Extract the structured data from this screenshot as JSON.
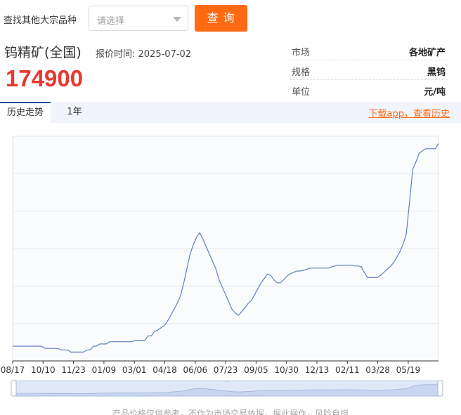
{
  "search": {
    "label": "查找其他大宗品种",
    "placeholder": "请选择",
    "button": "查 询"
  },
  "product": {
    "name": "钨精矿(全国)",
    "quote_time": "报价时间: 2025-07-02",
    "price": "174900"
  },
  "info": [
    {
      "key": "市场",
      "value": "各地矿产"
    },
    {
      "key": "规格",
      "value": "黑钨"
    },
    {
      "key": "单位",
      "value": "元/吨"
    }
  ],
  "tabs": {
    "history": "历史走势",
    "year": "1年",
    "download": "下载app，查看历史"
  },
  "disclaimer": "产品价格仅供参考，不作为市场交易依据，据此操作，风险自担",
  "colors": {
    "accent": "#ff6a13",
    "price": "#e8382f",
    "line": "#5b7fc0"
  },
  "chart_data": {
    "type": "line",
    "x_tick_labels": [
      "08/17",
      "10/10",
      "11/23",
      "01/09",
      "03/01",
      "04/18",
      "06/06",
      "07/23",
      "09/05",
      "10/30",
      "12/13",
      "02/11",
      "03/28",
      "05/19"
    ],
    "grid": true,
    "y_axis_labels_shown": false,
    "series": [
      {
        "values": [
          0.0,
          0.0,
          0.0,
          0.0,
          0.0,
          0.0,
          0.0,
          0.0,
          0.0,
          0.0,
          -0.03,
          -0.03,
          -0.03,
          -0.03,
          -0.03,
          -0.05,
          -0.05,
          -0.05,
          -0.08,
          -0.08,
          -0.08,
          -0.08,
          -0.08,
          -0.05,
          -0.05,
          0.0,
          0.0,
          0.03,
          0.03,
          0.03,
          0.06,
          0.06,
          0.06,
          0.06,
          0.06,
          0.06,
          0.06,
          0.06,
          0.08,
          0.08,
          0.08,
          0.08,
          0.14,
          0.14,
          0.2,
          0.22,
          0.25,
          0.28,
          0.34,
          0.42,
          0.5,
          0.58,
          0.68,
          0.85,
          1.05,
          1.25,
          1.38,
          1.48,
          1.54,
          1.45,
          1.35,
          1.25,
          1.15,
          1.05,
          0.9,
          0.8,
          0.7,
          0.6,
          0.5,
          0.45,
          0.42,
          0.47,
          0.52,
          0.58,
          0.62,
          0.7,
          0.78,
          0.86,
          0.92,
          0.98,
          0.96,
          0.9,
          0.86,
          0.86,
          0.9,
          0.95,
          0.98,
          1.0,
          1.02,
          1.02,
          1.03,
          1.04,
          1.06,
          1.06,
          1.06,
          1.06,
          1.06,
          1.06,
          1.06,
          1.08,
          1.09,
          1.1,
          1.1,
          1.1,
          1.1,
          1.1,
          1.09,
          1.09,
          1.08,
          1.0,
          0.93,
          0.93,
          0.93,
          0.93,
          0.96,
          1.0,
          1.04,
          1.08,
          1.13,
          1.2,
          1.28,
          1.38,
          1.52,
          1.95,
          2.4,
          2.5,
          2.62,
          2.65,
          2.68,
          2.68,
          2.68,
          2.68,
          2.75
        ]
      }
    ]
  }
}
